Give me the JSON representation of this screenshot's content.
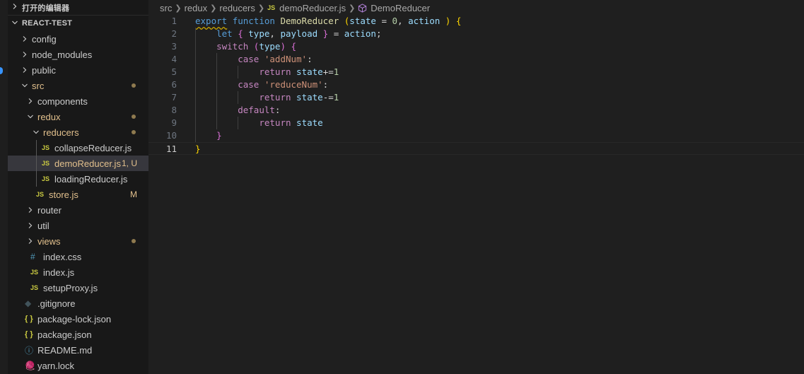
{
  "sidebar": {
    "open_editors_title": "打开的编辑器",
    "project_title": "REACT-TEST",
    "tree": [
      {
        "label": "config",
        "type": "folder",
        "depth": 0
      },
      {
        "label": "node_modules",
        "type": "folder",
        "depth": 0
      },
      {
        "label": "public",
        "type": "folder",
        "depth": 0
      },
      {
        "label": "src",
        "type": "folder-open",
        "depth": 0,
        "modified": true,
        "dot": true
      },
      {
        "label": "components",
        "type": "folder",
        "depth": 1
      },
      {
        "label": "redux",
        "type": "folder-open",
        "depth": 1,
        "modified": true,
        "dot": true
      },
      {
        "label": "reducers",
        "type": "folder-open",
        "depth": 2,
        "modified": true,
        "dot": true
      },
      {
        "label": "collapseReducer.js",
        "type": "js",
        "depth": 3
      },
      {
        "label": "demoReducer.js",
        "type": "js",
        "depth": 3,
        "modified": true,
        "status": "1, U",
        "active": true
      },
      {
        "label": "loadingReducer.js",
        "type": "js",
        "depth": 3
      },
      {
        "label": "store.js",
        "type": "js",
        "depth": 2,
        "modified": true,
        "status": "M"
      },
      {
        "label": "router",
        "type": "folder",
        "depth": 1
      },
      {
        "label": "util",
        "type": "folder",
        "depth": 1
      },
      {
        "label": "views",
        "type": "folder",
        "depth": 1,
        "modified": true,
        "dot": true
      },
      {
        "label": "index.css",
        "type": "css",
        "depth": 1
      },
      {
        "label": "index.js",
        "type": "js",
        "depth": 1
      },
      {
        "label": "setupProxy.js",
        "type": "js",
        "depth": 1
      },
      {
        "label": ".gitignore",
        "type": "git",
        "depth": 0
      },
      {
        "label": "package-lock.json",
        "type": "json",
        "depth": 0
      },
      {
        "label": "package.json",
        "type": "json",
        "depth": 0
      },
      {
        "label": "README.md",
        "type": "info",
        "depth": 0
      },
      {
        "label": "yarn.lock",
        "type": "yarn",
        "depth": 0
      }
    ]
  },
  "icons": {
    "js": "JS",
    "css": "#",
    "json": "{ }",
    "info": "ⓘ",
    "git": "◆",
    "yarn": "🧶"
  },
  "breadcrumb": {
    "items": [
      "src",
      "redux",
      "reducers"
    ],
    "file": "demoReducer.js",
    "symbol": "DemoReducer"
  },
  "editor": {
    "current_line": 11,
    "lines": [
      {
        "n": "1",
        "indent": 0,
        "tokens": [
          [
            "kw squig",
            "export"
          ],
          [
            "pun",
            " "
          ],
          [
            "kw",
            "function"
          ],
          [
            "pun",
            " "
          ],
          [
            "fn",
            "DemoReducer"
          ],
          [
            "pun",
            " "
          ],
          [
            "br1",
            "("
          ],
          [
            "var",
            "state"
          ],
          [
            "pun",
            " = "
          ],
          [
            "num",
            "0"
          ],
          [
            "pun",
            ", "
          ],
          [
            "var",
            "action"
          ],
          [
            "pun",
            " "
          ],
          [
            "br1",
            ")"
          ],
          [
            "pun",
            " "
          ],
          [
            "br1",
            "{"
          ]
        ]
      },
      {
        "n": "2",
        "indent": 1,
        "tokens": [
          [
            "kw",
            "let"
          ],
          [
            "pun",
            " "
          ],
          [
            "br2",
            "{"
          ],
          [
            "pun",
            " "
          ],
          [
            "var",
            "type"
          ],
          [
            "pun",
            ", "
          ],
          [
            "var",
            "payload"
          ],
          [
            "pun",
            " "
          ],
          [
            "br2",
            "}"
          ],
          [
            "pun",
            " = "
          ],
          [
            "var",
            "action"
          ],
          [
            "pun",
            ";"
          ]
        ]
      },
      {
        "n": "3",
        "indent": 1,
        "tokens": [
          [
            "ctl",
            "switch"
          ],
          [
            "pun",
            " "
          ],
          [
            "br2",
            "("
          ],
          [
            "var",
            "type"
          ],
          [
            "br2",
            ")"
          ],
          [
            "pun",
            " "
          ],
          [
            "br2",
            "{"
          ]
        ]
      },
      {
        "n": "4",
        "indent": 2,
        "tokens": [
          [
            "ctl",
            "case"
          ],
          [
            "pun",
            " "
          ],
          [
            "str",
            "'addNum'"
          ],
          [
            "pun",
            ":"
          ]
        ]
      },
      {
        "n": "5",
        "indent": 3,
        "tokens": [
          [
            "ctl",
            "return"
          ],
          [
            "pun",
            " "
          ],
          [
            "var",
            "state"
          ],
          [
            "pun",
            "+="
          ],
          [
            "num",
            "1"
          ]
        ]
      },
      {
        "n": "6",
        "indent": 2,
        "tokens": [
          [
            "ctl",
            "case"
          ],
          [
            "pun",
            " "
          ],
          [
            "str",
            "'reduceNum'"
          ],
          [
            "pun",
            ":"
          ]
        ]
      },
      {
        "n": "7",
        "indent": 3,
        "tokens": [
          [
            "ctl",
            "return"
          ],
          [
            "pun",
            " "
          ],
          [
            "var",
            "state"
          ],
          [
            "pun",
            "-="
          ],
          [
            "num",
            "1"
          ]
        ]
      },
      {
        "n": "8",
        "indent": 2,
        "tokens": [
          [
            "ctl",
            "default"
          ],
          [
            "pun",
            ":"
          ]
        ]
      },
      {
        "n": "9",
        "indent": 3,
        "tokens": [
          [
            "ctl",
            "return"
          ],
          [
            "pun",
            " "
          ],
          [
            "var",
            "state"
          ]
        ]
      },
      {
        "n": "10",
        "indent": 1,
        "tokens": [
          [
            "br2",
            "}"
          ]
        ]
      },
      {
        "n": "11",
        "indent": 0,
        "tokens": [
          [
            "br1",
            "}"
          ]
        ]
      }
    ]
  },
  "colors": {
    "accent": "#3794ff",
    "modified": "#e2c08d",
    "js_icon": "#cbcb41",
    "active_row": "#37373d"
  }
}
